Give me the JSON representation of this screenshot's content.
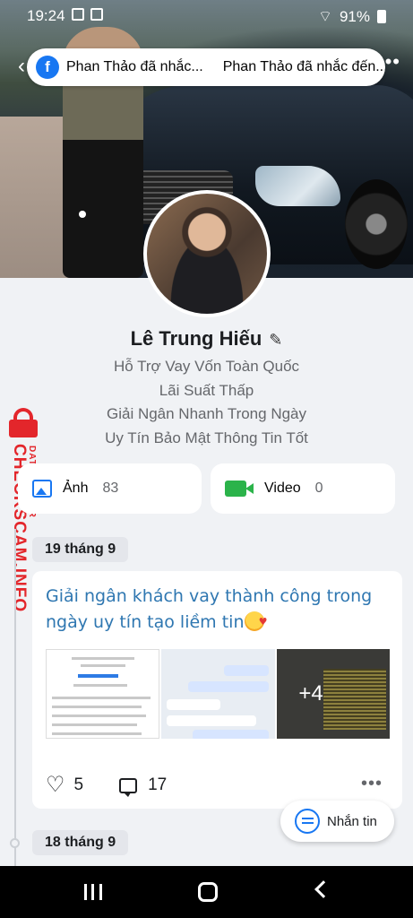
{
  "status_bar": {
    "time": "19:24",
    "battery": "91%"
  },
  "notification": {
    "app_icon": "facebook-icon",
    "text_primary": "Phan Thảo đã nhắc...",
    "text_secondary": "Phan Thảo đã nhắc đến..."
  },
  "profile": {
    "name": "Lê Trung Hiếu",
    "bio_lines": [
      "Hỗ Trợ Vay Vốn Toàn Quốc",
      "Lãi Suất Thấp",
      "Giải Ngân Nhanh Trong Ngày",
      "Uy Tín Bảo Mật Thông Tin Tốt"
    ]
  },
  "watermark": {
    "brand": "CHECKSCAM.INFO",
    "tag": "DATA CENTER"
  },
  "media": {
    "photos_label": "Ảnh",
    "photos_count": "83",
    "video_label": "Video",
    "video_count": "0"
  },
  "timeline": {
    "date_1": "19 tháng 9",
    "date_2": "18 tháng 9"
  },
  "post": {
    "text": "Giải ngân khách vay thành công trong ngày uy tín tạo liềm tin",
    "extra_photos": "+4",
    "likes": "5",
    "comments": "17"
  },
  "floating_button": {
    "label": "Nhắn tin"
  },
  "colors": {
    "facebook_blue": "#1877f2",
    "post_text": "#2f77b1",
    "video_green": "#2bb34a",
    "watermark_red": "#e3262b"
  }
}
